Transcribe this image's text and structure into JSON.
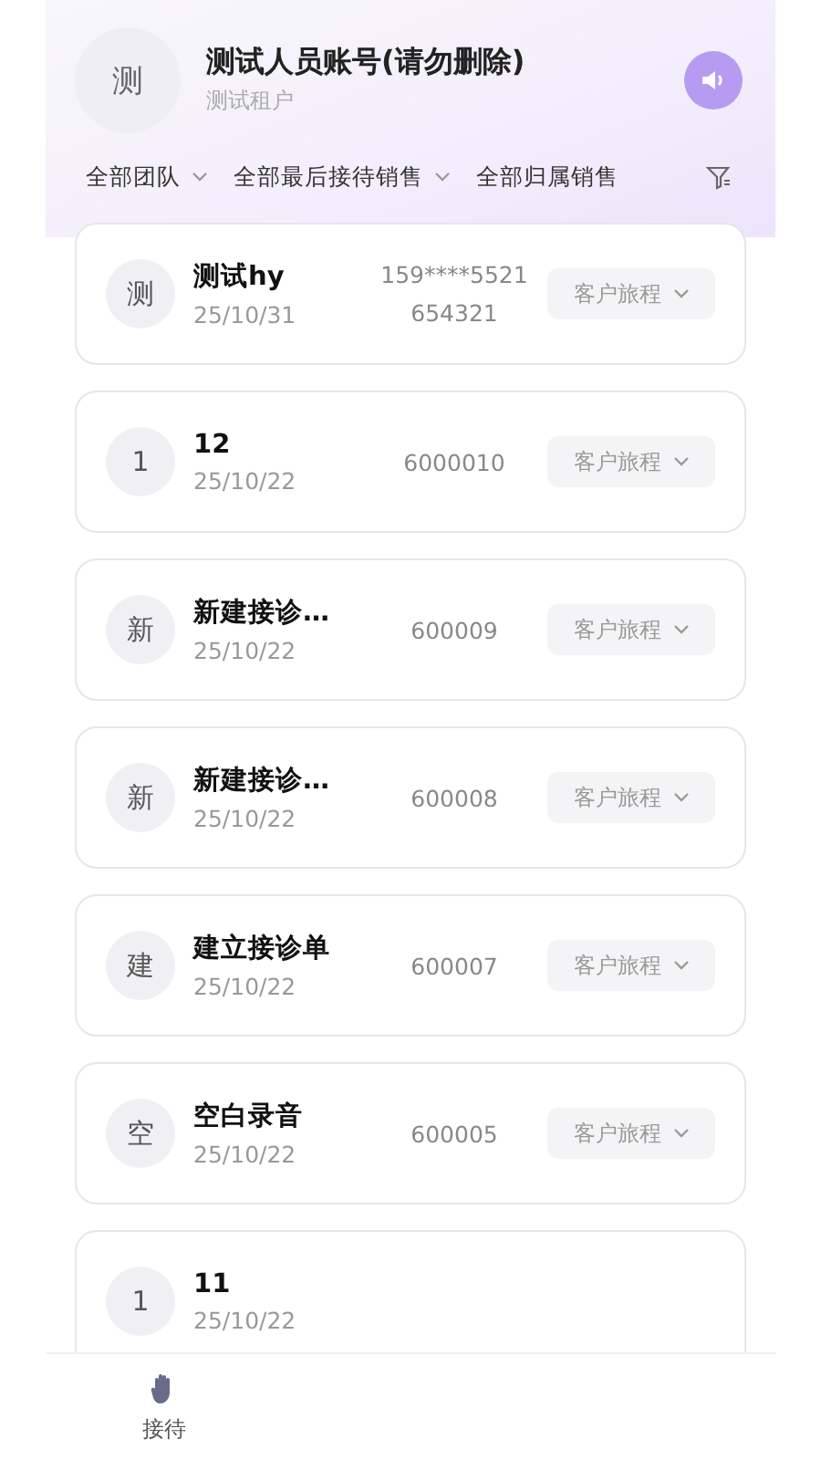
{
  "account": {
    "avatar": "测",
    "name": "测试人员账号(请勿删除)",
    "tenant": "测试租户"
  },
  "filters": [
    {
      "label": "全部团队",
      "dropdown": true
    },
    {
      "label": "全部最后接待销售",
      "dropdown": true
    },
    {
      "label": "全部归属销售",
      "dropdown": false
    }
  ],
  "customers": [
    {
      "avatar": "测",
      "name": "测试hy",
      "date": "25/10/31",
      "numbers": [
        "159****5521",
        "654321"
      ],
      "journey": "客户旅程"
    },
    {
      "avatar": "1",
      "name": "12",
      "date": "25/10/22",
      "numbers": [
        "6000010"
      ],
      "journey": "客户旅程"
    },
    {
      "avatar": "新",
      "name": "新建接诊…",
      "date": "25/10/22",
      "numbers": [
        "600009"
      ],
      "journey": "客户旅程"
    },
    {
      "avatar": "新",
      "name": "新建接诊…",
      "date": "25/10/22",
      "numbers": [
        "600008"
      ],
      "journey": "客户旅程"
    },
    {
      "avatar": "建",
      "name": "建立接诊单",
      "date": "25/10/22",
      "numbers": [
        "600007"
      ],
      "journey": "客户旅程"
    },
    {
      "avatar": "空",
      "name": "空白录音",
      "date": "25/10/22",
      "numbers": [
        "600005"
      ],
      "journey": "客户旅程"
    },
    {
      "avatar": "1",
      "name": "11",
      "date": "25/10/22"
    }
  ],
  "bottom_nav": [
    {
      "label": "接待",
      "selected": true
    }
  ]
}
